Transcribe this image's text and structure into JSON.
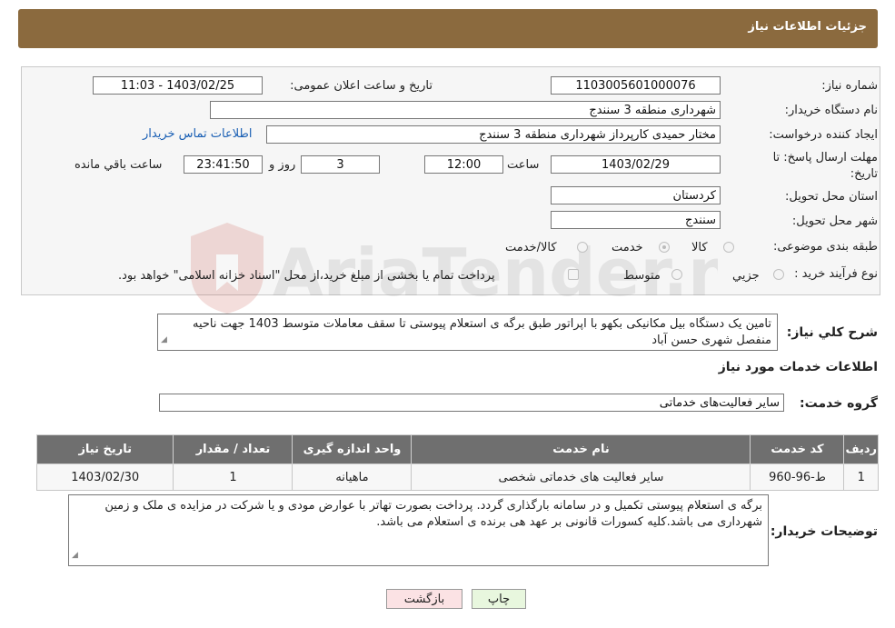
{
  "header": {
    "title": "جزئیات اطلاعات نیاز"
  },
  "form": {
    "need_number": {
      "label": "شماره نیاز:",
      "value": "1103005601000076"
    },
    "announce_datetime": {
      "label": "تاریخ و ساعت اعلان عمومی:",
      "value": "1403/02/25 - 11:03"
    },
    "buyer_org": {
      "label": "نام دستگاه خریدار:",
      "value": "شهرداری منطقه 3 سنندج"
    },
    "requester": {
      "label": "ایجاد کننده درخواست:",
      "value": "مختار حمیدی کارپرداز شهرداری منطقه 3 سنندج"
    },
    "contact_link": "اطلاعات تماس خریدار",
    "deadline": {
      "label": "مهلت ارسال پاسخ: تا تاریخ:",
      "date": "1403/02/29",
      "time_label": "ساعت",
      "time": "12:00",
      "days": "3",
      "days_label": "روز و",
      "remaining": "23:41:50",
      "remaining_label": "ساعت باقي مانده"
    },
    "province": {
      "label": "استان محل تحویل:",
      "value": "کردستان"
    },
    "city": {
      "label": "شهر محل تحویل:",
      "value": "سنندج"
    },
    "category": {
      "label": "طبقه بندی موضوعی:",
      "options": [
        "کالا",
        "خدمت",
        "کالا/خدمت"
      ],
      "selected": "خدمت"
    },
    "purchase_type": {
      "label": "نوع فرآیند خرید :",
      "options": [
        "جزیي",
        "متوسط"
      ],
      "note": "پرداخت تمام یا بخشی از مبلغ خرید،از محل \"اسناد خزانه اسلامی\" خواهد بود."
    }
  },
  "watermark": "AriaTender.neT",
  "description": {
    "label": "شرح کلي نياز:",
    "text": "تامین  یک دستگاه بیل مکانیکی بکهو با اپراتور  طبق برگه ی استعلام پیوستی تا سقف معاملات متوسط  1403 جهت ناحیه منفصل شهری حسن آباد"
  },
  "services_section": {
    "title": "اطلاعات خدمات مورد نياز",
    "group_label": "گروه خدمت:",
    "group_value": "سایر فعالیت‌های خدماتی"
  },
  "table": {
    "headers": [
      "رديف",
      "کد خدمت",
      "نام خدمت",
      "واحد اندازه گيری",
      "تعداد / مقدار",
      "تاريخ نياز"
    ],
    "rows": [
      [
        "1",
        "ط-96-960",
        "سایر فعالیت های خدماتی شخصی",
        "ماهیانه",
        "1",
        "1403/02/30"
      ]
    ]
  },
  "buyer_notes": {
    "label": "توضيحات خريدار:",
    "text": "برگه ی استعلام پیوستی تکمیل و در سامانه بارگذاری گردد. پرداخت بصورت تهاتر با عوارض مودی و یا شرکت در مزایده ی ملک و زمین شهرداری می باشد.کلیه کسورات قانونی بر عهد هی برنده ی استعلام می باشد."
  },
  "buttons": {
    "print": "چاپ",
    "back": "بازگشت"
  }
}
